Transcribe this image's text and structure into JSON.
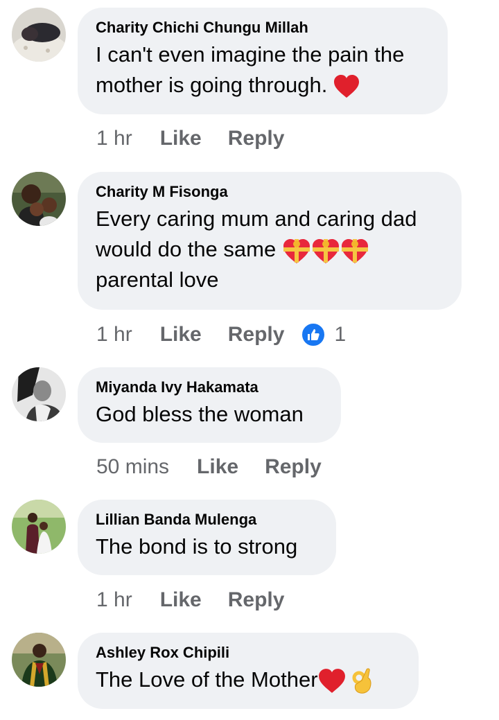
{
  "comments": [
    {
      "author": "Charity Chichi Chungu Millah",
      "lines": [
        "I can't even imagine the pain the",
        "mother is going through."
      ],
      "time": "1 hr",
      "like": "Like",
      "reply": "Reply"
    },
    {
      "author": "Charity M Fisonga",
      "lines": [
        "Every caring mum and caring dad",
        "would do the same",
        "parental love"
      ],
      "time": "1 hr",
      "like": "Like",
      "reply": "Reply",
      "reaction_count": "1"
    },
    {
      "author": "Miyanda Ivy Hakamata",
      "lines": [
        "God bless the woman"
      ],
      "time": "50 mins",
      "like": "Like",
      "reply": "Reply"
    },
    {
      "author": "Lillian Banda Mulenga",
      "lines": [
        "The bond is to strong"
      ],
      "time": "1 hr",
      "like": "Like",
      "reply": "Reply"
    },
    {
      "author": "Ashley Rox Chipili",
      "lines": [
        "The Love of the Mother"
      ],
      "time": "",
      "like": "",
      "reply": ""
    }
  ],
  "icons": {
    "heart": "red-heart-icon",
    "gift_heart": "heart-with-ribbon-icon",
    "ok_hand": "ok-hand-icon",
    "like_reaction": "thumbs-up-icon"
  },
  "colors": {
    "bubble": "#eff1f4",
    "meta_text": "#65676b",
    "like_blue": "#1877f2",
    "heart_red": "#e0202c"
  }
}
